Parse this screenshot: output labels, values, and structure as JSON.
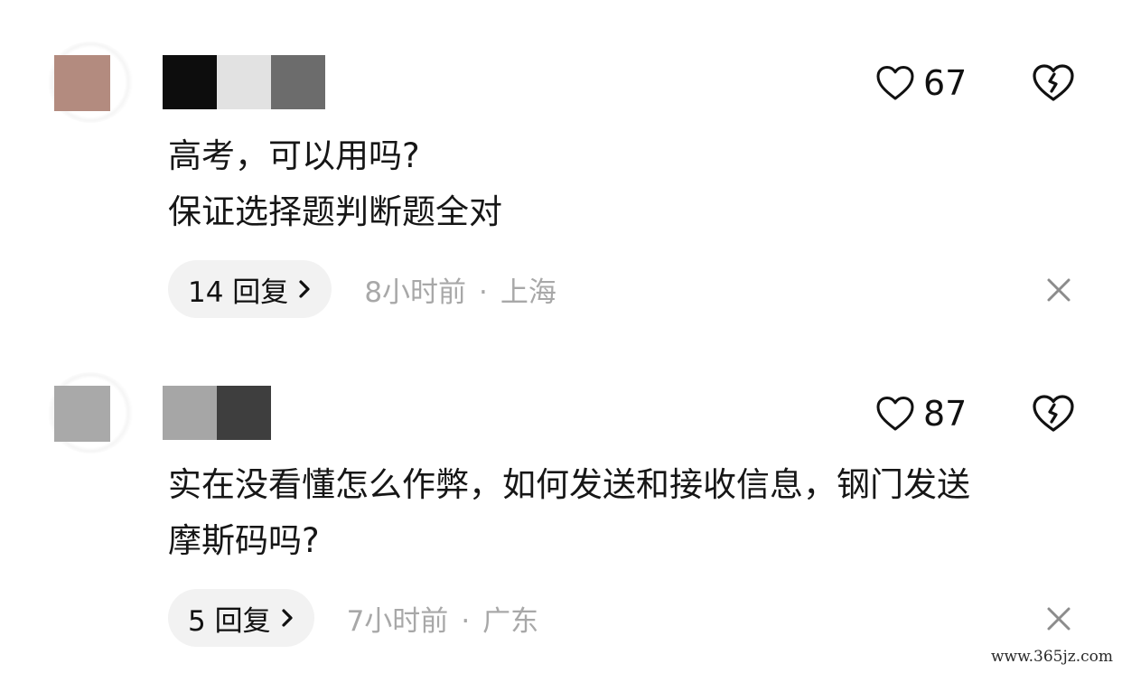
{
  "comments": [
    {
      "avatar_color": "#b38b7f",
      "name_blocks": [
        "#0d0d0d",
        "#e2e2e2",
        "#6c6c6c"
      ],
      "like_count": "67",
      "lines": [
        "高考，可以用吗?",
        "保证选择题判断题全对"
      ],
      "reply_label": "14 回复",
      "time": "8小时前",
      "location": "上海"
    },
    {
      "avatar_color": "#a9a9a9",
      "name_blocks": [
        "#a6a6a6",
        "#3e3e3e"
      ],
      "like_count": "87",
      "lines": [
        "实在没看懂怎么作弊，如何发送和接收信息，钢门发送",
        "摩斯码吗?"
      ],
      "reply_label": "5 回复",
      "time": "7小时前",
      "location": "广东"
    }
  ],
  "separator": "·",
  "icons": {
    "like": "heart-icon",
    "dislike": "broken-heart-icon",
    "reply_arrow": "chevron-right-icon",
    "dismiss": "close-icon"
  },
  "watermark": "www.365jz.com"
}
